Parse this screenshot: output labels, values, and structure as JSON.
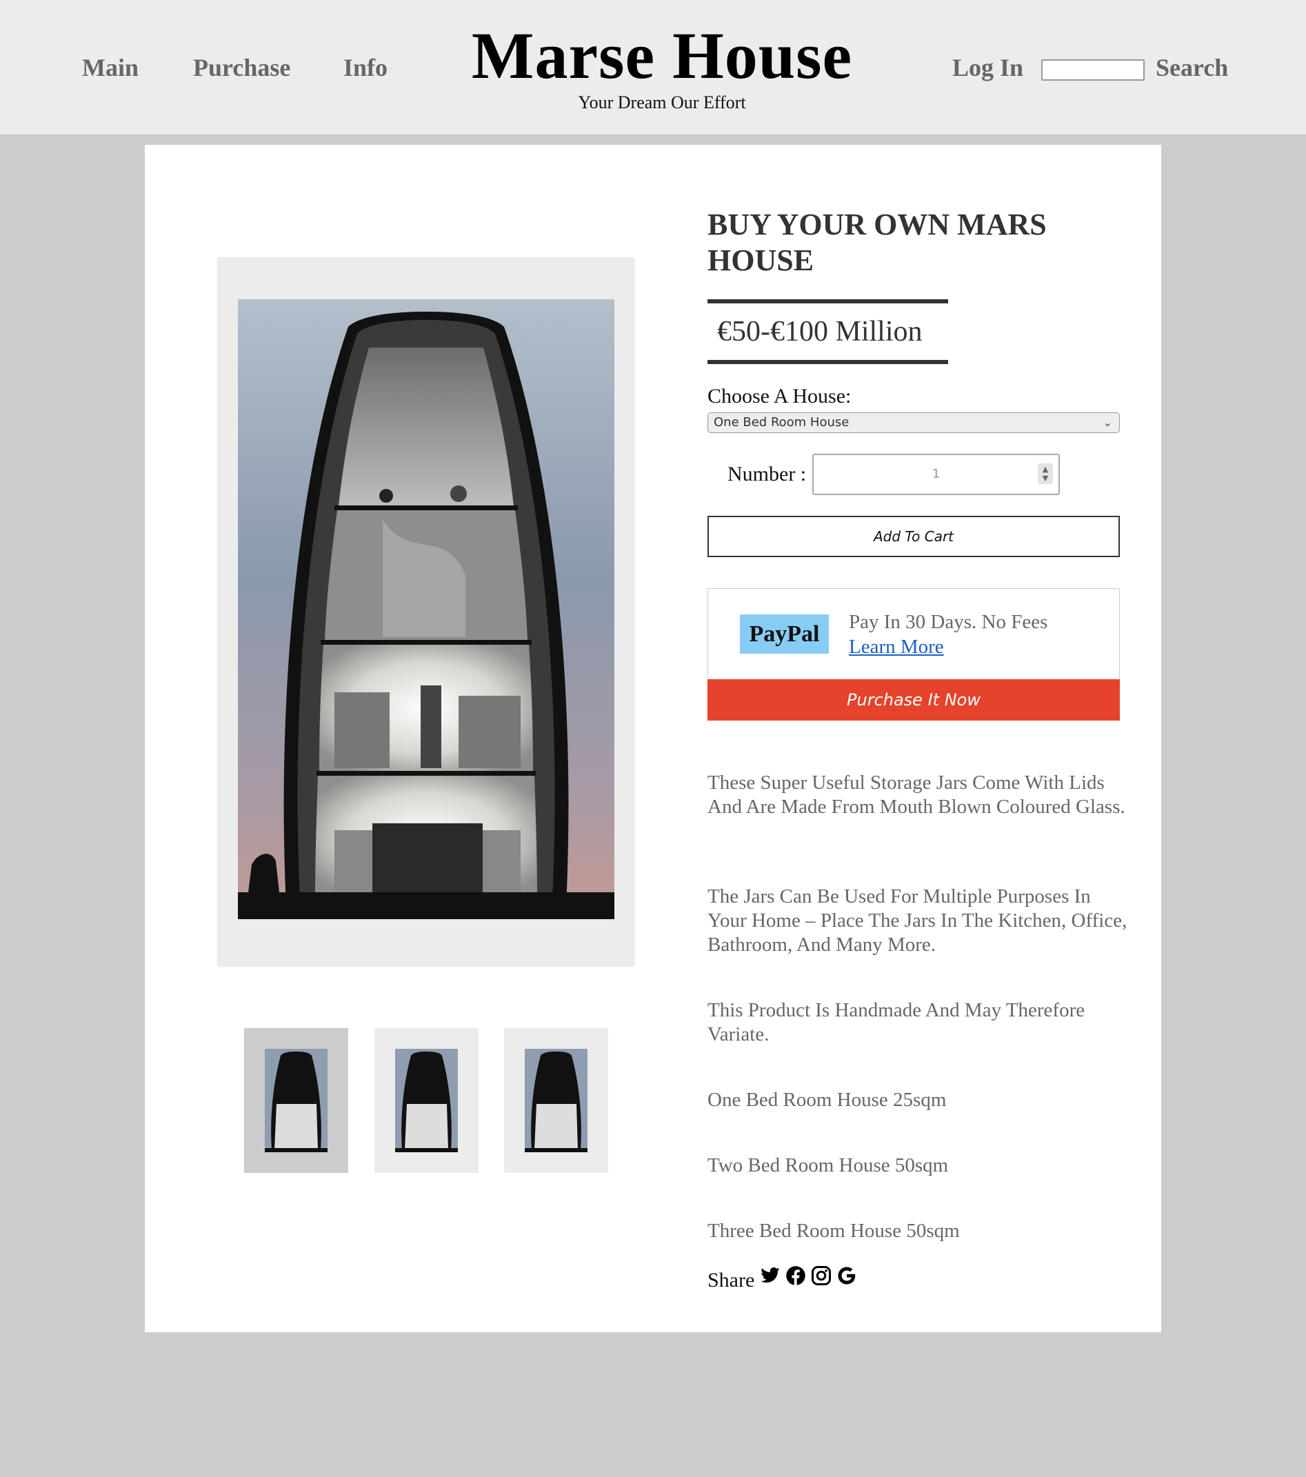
{
  "nav": {
    "items": [
      "Main",
      "Purchase",
      "Info"
    ],
    "login": "Log In",
    "search": "Search",
    "search_value": ""
  },
  "brand": {
    "title": "Marse House",
    "tagline": "Your Dream Our Effort"
  },
  "product": {
    "title": "BUY YOUR OWN MARS HOUSE",
    "price": "€50-€100 Million",
    "choose_label": "Choose A House:",
    "selected_house": "One Bed Room House",
    "number_label": "Number :",
    "quantity": "1",
    "add_to_cart": "Add To Cart"
  },
  "payment": {
    "paypal": "PayPal",
    "pay_text": "Pay In 30 Days. No Fees",
    "learn_more": "Learn More",
    "purchase_now": "Purchase It Now"
  },
  "description": [
    "These Super Useful Storage Jars Come With Lids And Are Made From Mouth Blown Coloured Glass.",
    "The Jars Can Be Used For Multiple Purposes In Your Home – Place The Jars In The Kitchen, Office, Bathroom, And Many More.",
    "This Product Is Handmade And May Therefore Variate.",
    "One Bed Room House 25sqm",
    "Two Bed Room House 50sqm",
    "Three Bed Room House 50sqm"
  ],
  "share": {
    "label": "Share",
    "icons": [
      "twitter-icon",
      "facebook-icon",
      "instagram-icon",
      "google-icon"
    ]
  },
  "colors": {
    "header_bg": "#ececec",
    "page_bg": "#cccccc",
    "paypal_badge": "#87ccf5",
    "purchase_button": "#e5432b",
    "link": "#1a5fc8"
  }
}
